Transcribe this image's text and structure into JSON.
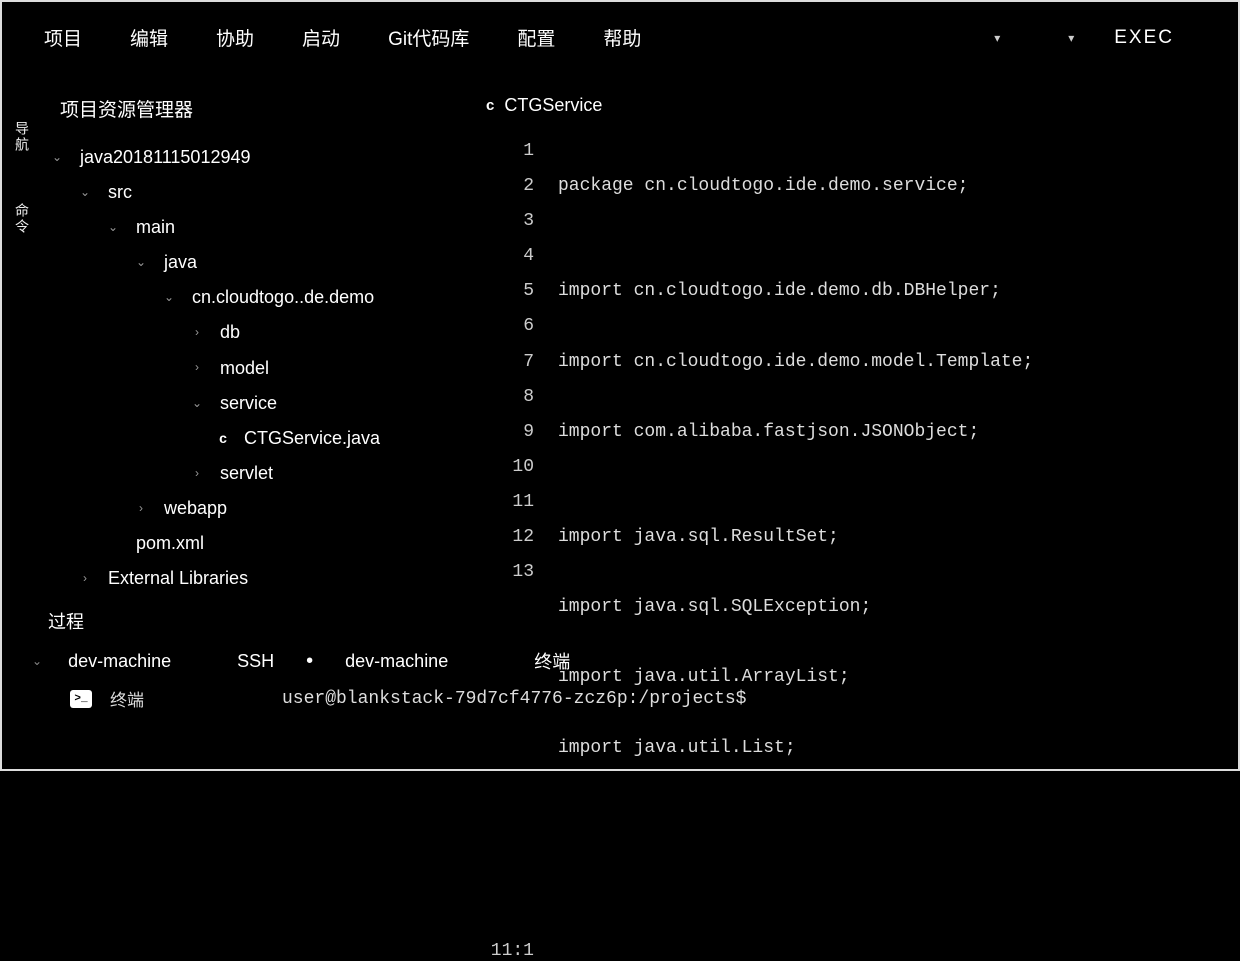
{
  "menubar": {
    "project": "项目",
    "edit": "编辑",
    "assist": "协助",
    "run": "启动",
    "git": "Git代码库",
    "config": "配置",
    "help": "帮助",
    "exec": "EXEC"
  },
  "sidebar": {
    "tab1": "导航",
    "tab2": "命令"
  },
  "explorer": {
    "title": "项目资源管理器",
    "root": "java20181115012949",
    "src": "src",
    "main": "main",
    "java": "java",
    "pkg": "cn.cloudtogo..de.demo",
    "db": "db",
    "model": "model",
    "service": "service",
    "file": "CTGService.java",
    "servlet": "servlet",
    "webapp": "webapp",
    "pom": "pom.xml",
    "ext": "External Libraries"
  },
  "editor": {
    "tabname": "CTGService",
    "cursor": "11:1",
    "lines": [
      "package cn.cloudtogo.ide.demo.service;",
      "",
      "import cn.cloudtogo.ide.demo.db.DBHelper;",
      "import cn.cloudtogo.ide.demo.model.Template;",
      "import com.alibaba.fastjson.JSONObject;",
      "",
      "import java.sql.ResultSet;",
      "import java.sql.SQLException;",
      "import java.util.ArrayList;",
      "import java.util.List;",
      "",
      "",
      ""
    ]
  },
  "bottom": {
    "process": "过程",
    "machine": "dev-machine",
    "ssh": "SSH",
    "machine2": "dev-machine",
    "terminal_cn": "终端",
    "term_name": "终端",
    "prompt": "user@blankstack-79d7cf4776-zcz6p:/projects$"
  }
}
